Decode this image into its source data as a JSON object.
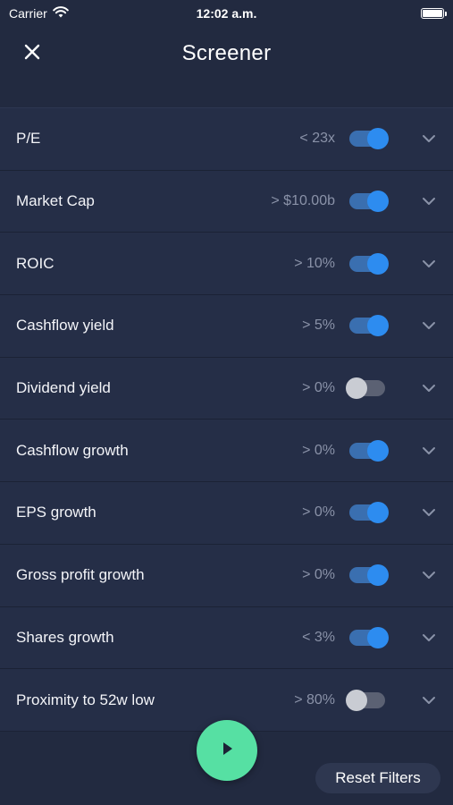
{
  "status": {
    "carrier": "Carrier",
    "time": "12:02 a.m."
  },
  "header": {
    "title": "Screener"
  },
  "filters": [
    {
      "label": "P/E",
      "value": "< 23x",
      "enabled": true
    },
    {
      "label": "Market Cap",
      "value": "> $10.00b",
      "enabled": true
    },
    {
      "label": "ROIC",
      "value": "> 10%",
      "enabled": true
    },
    {
      "label": "Cashflow yield",
      "value": "> 5%",
      "enabled": true
    },
    {
      "label": "Dividend yield",
      "value": "> 0%",
      "enabled": false
    },
    {
      "label": "Cashflow growth",
      "value": "> 0%",
      "enabled": true
    },
    {
      "label": "EPS growth",
      "value": "> 0%",
      "enabled": true
    },
    {
      "label": "Gross profit growth",
      "value": "> 0%",
      "enabled": true
    },
    {
      "label": "Shares growth",
      "value": "< 3%",
      "enabled": true
    },
    {
      "label": "Proximity to 52w low",
      "value": "> 80%",
      "enabled": false
    }
  ],
  "actions": {
    "reset_label": "Reset Filters"
  },
  "colors": {
    "background": "#222a40",
    "toggle_on": "#2d8cf0",
    "run_button": "#56e0a3"
  },
  "icons": {
    "close": "close-icon",
    "chevron": "chevron-down-icon",
    "play": "play-icon",
    "wifi": "wifi-icon",
    "battery": "battery-icon"
  }
}
